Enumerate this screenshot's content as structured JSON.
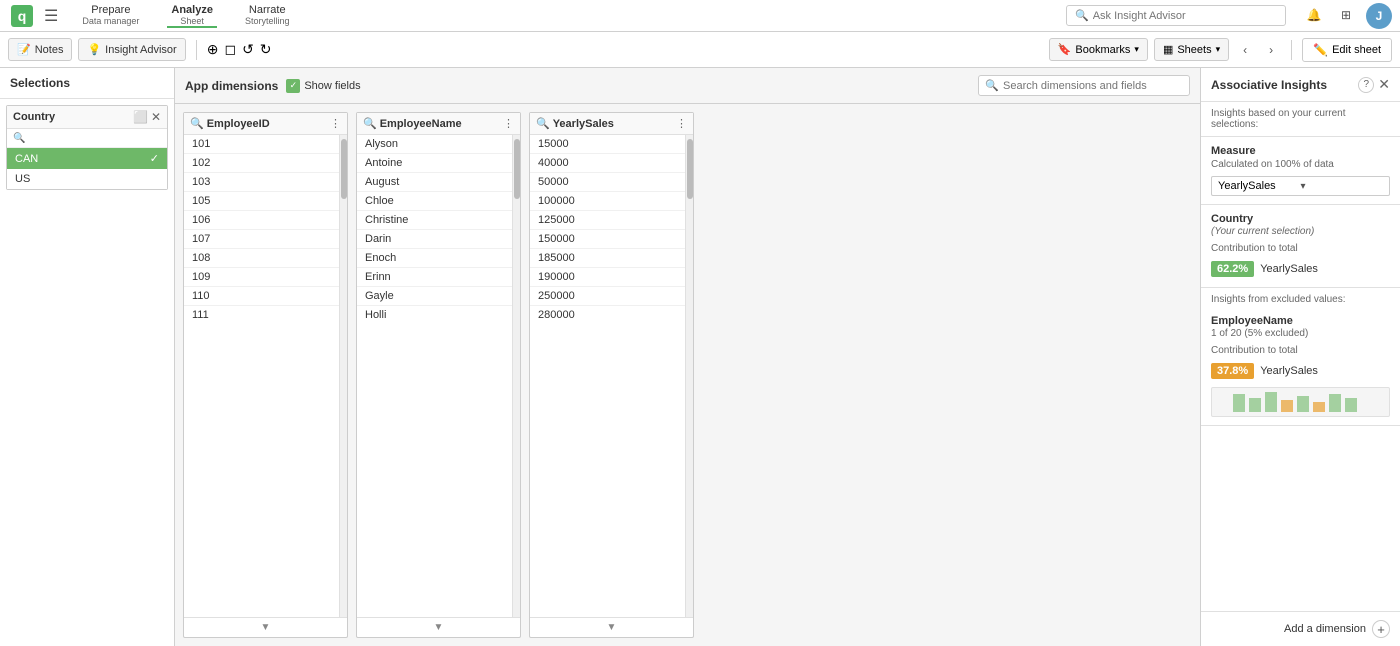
{
  "app": {
    "title": "Associative Insights"
  },
  "topbar": {
    "menu_icon": "☰",
    "prepare_label": "Prepare",
    "prepare_sub": "Data manager",
    "analyze_label": "Analyze",
    "analyze_sub": "Sheet",
    "narrate_label": "Narrate",
    "narrate_sub": "Storytelling",
    "search_placeholder": "Ask Insight Advisor",
    "notification_icon": "🔔",
    "grid_icon": "⊞",
    "user_icon": "👤"
  },
  "toolbar": {
    "notes_label": "Notes",
    "insight_advisor_label": "Insight Advisor",
    "smart_search_icon": "⊕",
    "edit_sheet_label": "Edit sheet",
    "bookmarks_label": "Bookmarks",
    "sheets_label": "Sheets",
    "nav_prev": "‹",
    "nav_next": "›"
  },
  "selections": {
    "header": "Selections",
    "listbox": {
      "title": "Country",
      "search_placeholder": "",
      "items": [
        {
          "value": "CAN",
          "state": "selected"
        },
        {
          "value": "US",
          "state": "possible"
        }
      ]
    }
  },
  "dimensions_bar": {
    "label": "App dimensions",
    "show_fields_label": "Show fields",
    "search_placeholder": "Search dimensions and fields"
  },
  "tables": [
    {
      "id": "employeeid",
      "title": "EmployeeID",
      "rows": [
        "101",
        "102",
        "103",
        "105",
        "106",
        "107",
        "108",
        "109",
        "110",
        "111"
      ]
    },
    {
      "id": "employeename",
      "title": "EmployeeName",
      "rows": [
        "Alyson",
        "Antoine",
        "August",
        "Chloe",
        "Christine",
        "Darin",
        "Enoch",
        "Erinn",
        "Gayle",
        "Holli"
      ]
    },
    {
      "id": "yearlysales",
      "title": "YearlySales",
      "rows": [
        "15000",
        "40000",
        "50000",
        "100000",
        "125000",
        "150000",
        "185000",
        "190000",
        "250000",
        "280000"
      ]
    }
  ],
  "insights": {
    "panel_title": "Associative Insights",
    "help_icon": "?",
    "close_icon": "✕",
    "subtext": "Insights based on your current selections:",
    "measure": {
      "label": "Measure",
      "sublabel": "Calculated on 100% of data",
      "selected_value": "YearlySales",
      "dropdown_chevron": "▾"
    },
    "current_selection_card": {
      "title": "Country",
      "subtitle": "(Your current selection)",
      "contribution_label": "Contribution to total",
      "pct": "62.2%",
      "pct_color": "green",
      "field": "YearlySales"
    },
    "excluded_section_label": "Insights from excluded values:",
    "excluded_card": {
      "title": "EmployeeName",
      "subtitle": "1 of 20 (5% excluded)",
      "contribution_label": "Contribution to total",
      "pct": "37.8%",
      "pct_color": "orange",
      "field": "YearlySales"
    },
    "add_dimension_label": "Add a dimension",
    "add_icon": "+"
  }
}
